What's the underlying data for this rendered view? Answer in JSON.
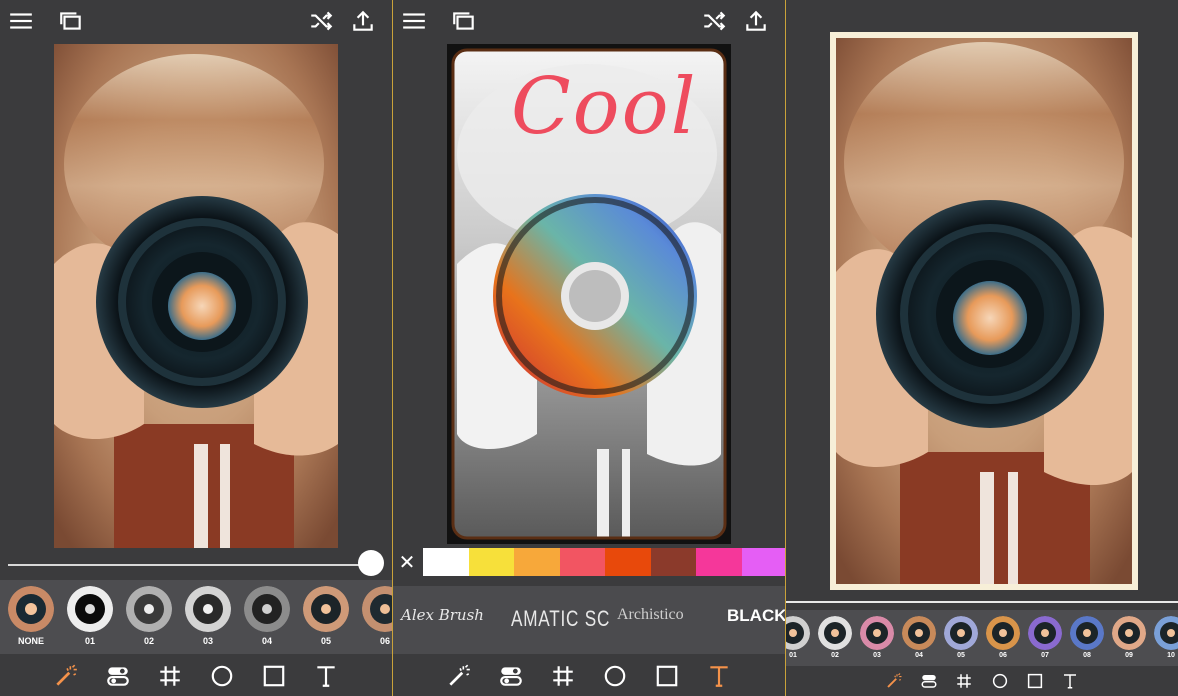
{
  "panels": [
    {
      "id": "effects",
      "thumb_labels": [
        "NONE",
        "01",
        "02",
        "03",
        "04",
        "05",
        "06"
      ],
      "active_tool": "magic-wand"
    },
    {
      "id": "text",
      "overlay_text": "Cool",
      "swatch_colors": [
        "#ffffff",
        "#f7e03a",
        "#f7a83a",
        "#f25562",
        "#e8490b",
        "#8b3a2b",
        "#f5379a",
        "#e55ef5"
      ],
      "fonts": [
        "Alex Brush",
        "AMATIC SC",
        "Archistico",
        "BLACKO"
      ],
      "active_tool": "text"
    },
    {
      "id": "frames",
      "thumb_labels": [
        "01",
        "02",
        "03",
        "04",
        "05",
        "06",
        "07",
        "08",
        "09",
        "10"
      ],
      "active_tool": "magic-wand"
    }
  ],
  "slider_value": 1.0,
  "colors": {
    "accent": "#f4924a",
    "background": "#3b3b3d",
    "divider": "#c9a23a"
  },
  "icons": [
    "menu-icon",
    "layers-icon",
    "shuffle-icon",
    "share-icon",
    "magic-wand-icon",
    "toggle-icon",
    "grid-icon",
    "circle-icon",
    "square-icon",
    "text-icon"
  ]
}
